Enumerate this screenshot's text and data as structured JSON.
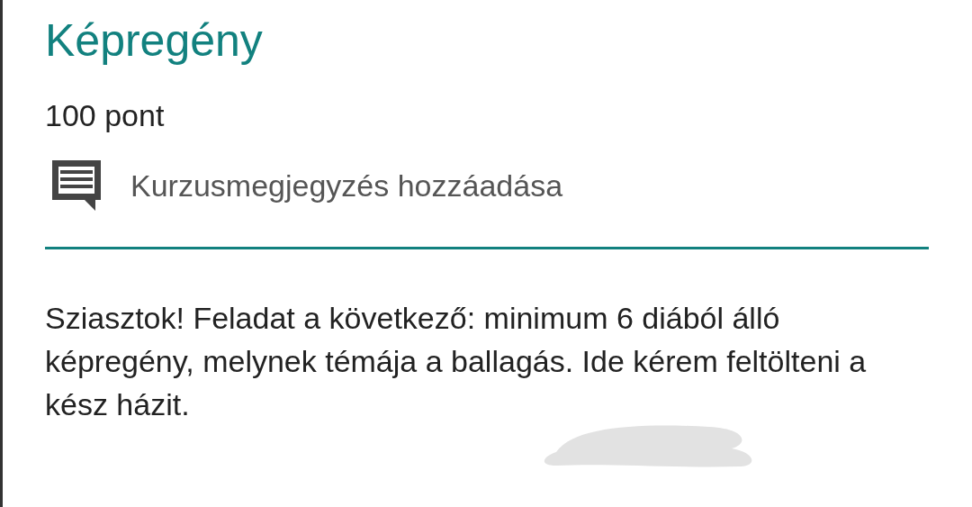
{
  "title": "Képregény",
  "points": "100 pont",
  "comment_button": {
    "label": "Kurzusmegjegyzés hozzáadása"
  },
  "description": "Sziasztok! Feladat a következő: minimum 6 diából álló képregény, melynek témája a ballagás. Ide kérem feltölteni a kész házit."
}
